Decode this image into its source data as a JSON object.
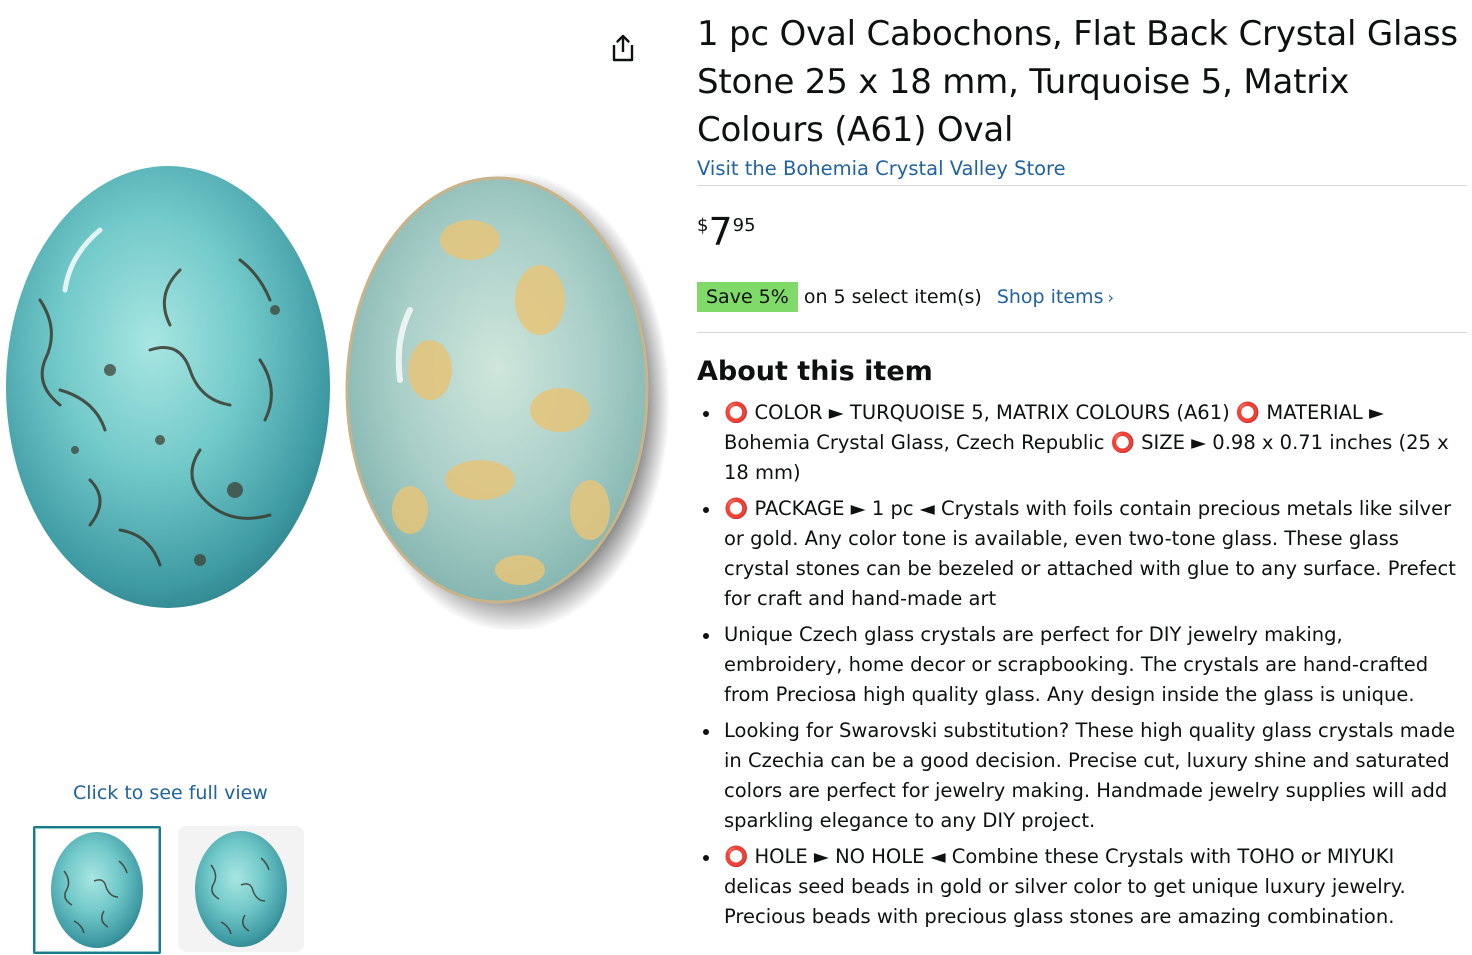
{
  "product": {
    "title": "1 pc Oval Cabochons, Flat Back Crystal Glass Stone 25 x 18 mm, Turquoise 5, Matrix Colours (A61) Oval",
    "store_link": "Visit the Bohemia Crystal Valley Store"
  },
  "price": {
    "symbol": "$",
    "whole": "7",
    "fraction": "95"
  },
  "promotion": {
    "badge": "Save 5%",
    "text": "on 5 select item(s)",
    "link": "Shop items",
    "link_icon": "chevron-right-icon"
  },
  "gallery": {
    "full_view_link": "Click to see full view",
    "share_icon": "share-icon",
    "thumbnails": [
      {
        "selected": true
      },
      {
        "selected": false
      }
    ],
    "colors": {
      "turquoise": "#6fc4c8",
      "matrix_dark": "#3b3a2e",
      "cream": "#e6c57a",
      "selected_border": "#1b7a8a"
    }
  },
  "about": {
    "heading": "About this item",
    "bullets": [
      "⭕ COLOR ► TURQUOISE 5, MATRIX COLOURS (A61) ⭕ MATERIAL ► Bohemia Crystal Glass, Czech Republic ⭕ SIZE ► 0.98 x 0.71 inches (25 x 18 mm)",
      "⭕ PACKAGE ► 1 pc ◄ Crystals with foils contain precious metals like silver or gold. Any color tone is available, even two-tone glass. These glass crystal stones can be bezeled or attached with glue to any surface. Prefect for craft and hand-made art",
      "Unique Czech glass crystals are perfect for DIY jewelry making, embroidery, home decor or scrapbooking. The crystals are hand-crafted from Preciosa high quality glass. Any design inside the glass is unique.",
      "Looking for Swarovski substitution? These high quality glass crystals made in Czechia can be a good decision. Precise cut, luxury shine and saturated colors are perfect for jewelry making. Handmade jewelry supplies will add sparkling elegance to any DIY project.",
      "⭕ HOLE ► NO HOLE ◄ Combine these Crystals with TOHO or MIYUKI delicas seed beads in gold or silver color to get unique luxury jewelry. Precious beads with precious glass stones are amazing combination."
    ]
  }
}
